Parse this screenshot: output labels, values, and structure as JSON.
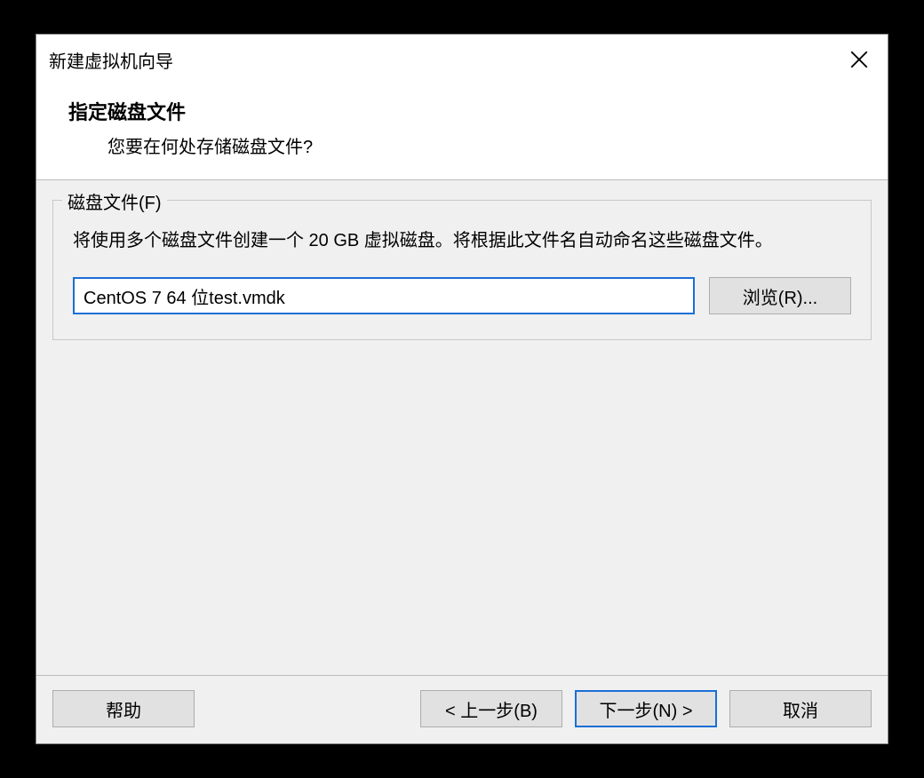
{
  "titlebar": {
    "title": "新建虚拟机向导"
  },
  "header": {
    "heading": "指定磁盘文件",
    "sub": "您要在何处存储磁盘文件?"
  },
  "fieldset": {
    "legend": "磁盘文件(F)",
    "description": "将使用多个磁盘文件创建一个 20 GB 虚拟磁盘。将根据此文件名自动命名这些磁盘文件。",
    "input_value": "CentOS 7 64 位test.vmdk",
    "browse_label": "浏览(R)..."
  },
  "footer": {
    "help_label": "帮助",
    "back_label": "< 上一步(B)",
    "next_label": "下一步(N) >",
    "cancel_label": "取消"
  }
}
